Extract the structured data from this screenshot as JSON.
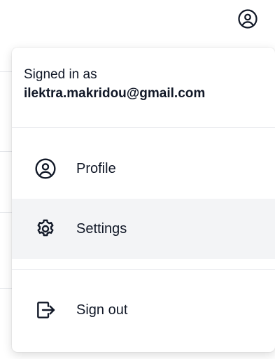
{
  "header": {
    "avatar_icon": "user-circle-icon"
  },
  "menu": {
    "signed_in_label": "Signed in as",
    "email": "ilektra.makridou@gmail.com",
    "items": [
      {
        "label": "Profile",
        "icon": "user-circle-icon"
      },
      {
        "label": "Settings",
        "icon": "gear-icon",
        "active": true
      },
      {
        "label": "Sign out",
        "icon": "sign-out-icon"
      }
    ]
  },
  "colors": {
    "active_bg": "#f3f4f6",
    "divider": "#e5e7eb",
    "text": "#111827"
  }
}
